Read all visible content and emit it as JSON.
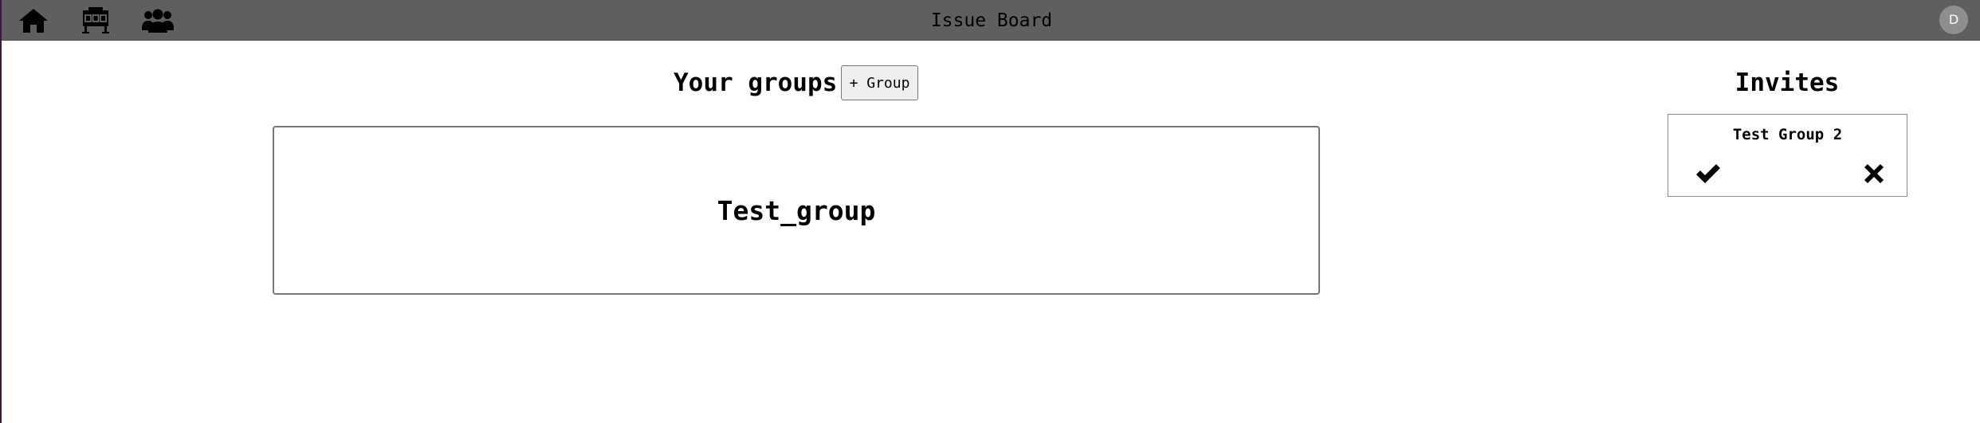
{
  "header": {
    "title": "Issue Board",
    "nav": [
      {
        "icon": "home-icon"
      },
      {
        "icon": "board-icon"
      },
      {
        "icon": "users-icon"
      }
    ],
    "avatar_initial": "D",
    "background_color": "#5f605d"
  },
  "groups": {
    "heading": "Your groups",
    "add_button_label": "+ Group",
    "items": [
      {
        "name": "Test_group"
      }
    ]
  },
  "invites": {
    "heading": "Invites",
    "items": [
      {
        "group_name": "Test Group 2",
        "accept_icon": "check-icon",
        "decline_icon": "close-icon"
      }
    ]
  }
}
